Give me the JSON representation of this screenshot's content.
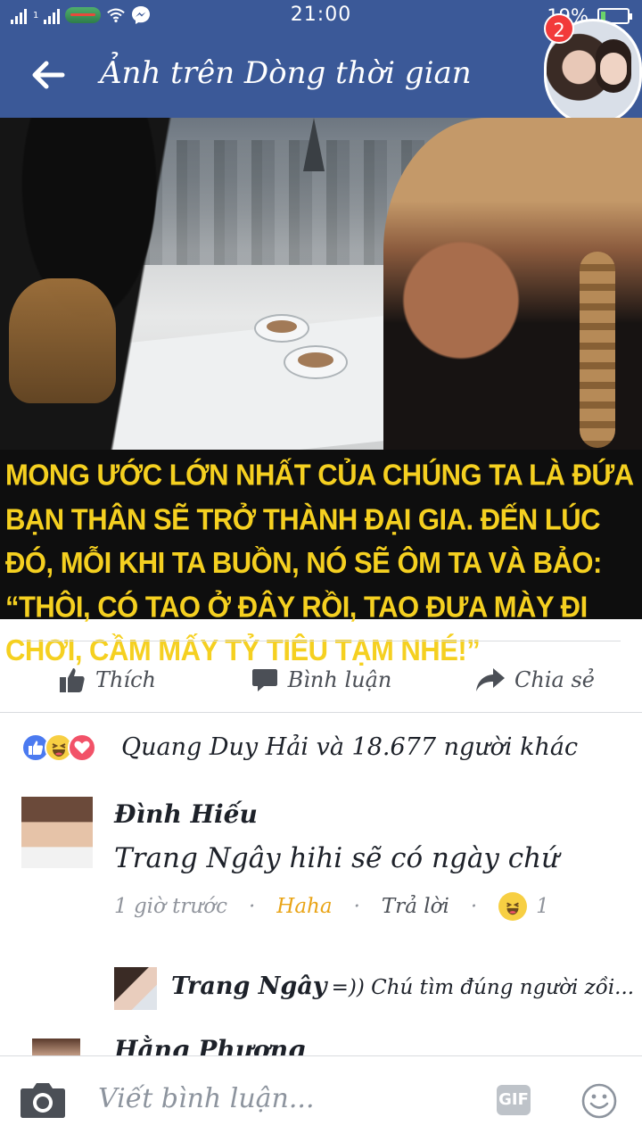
{
  "status_bar": {
    "time": "21:00",
    "battery_percent": "19%",
    "battery_level": 0.19,
    "carrier_icon": "carrier-logo-icon",
    "signal_label": "1"
  },
  "header": {
    "title": "Ảnh trên Dòng thời gian",
    "back_icon": "back-arrow-icon",
    "chat_badge": "2"
  },
  "post": {
    "caption": "Mong ước lớn nhất của chúng ta là đứa bạn thân sẽ trở thành đại gia. Đến lúc đó, mỗi khi ta buồn, nó sẽ ôm ta và bảo: “Thôi, có tao ở đây rồi, tao đưa mày đi chơi, cầm mấy tỷ tiêu tạm nhé!”"
  },
  "actions": {
    "like": "Thích",
    "comment": "Bình luận",
    "share": "Chia sẻ"
  },
  "reactions": {
    "summary": "Quang Duy Hải và 18.677 người khác"
  },
  "comments": [
    {
      "name": "Đình Hiếu",
      "text": "Trang Ngây hihi sẽ có ngày chứ",
      "time": "1 giờ trước",
      "reaction_label": "Haha",
      "reply_label": "Trả lời",
      "reaction_count": "1",
      "reply": {
        "name": "Trang Ngây",
        "text": "=)) Chú tìm đúng người zồi..."
      }
    },
    {
      "name": "Hằng Phương"
    }
  ],
  "composer": {
    "placeholder": "Viết bình luận...",
    "gif_label": "GIF"
  },
  "colors": {
    "facebook_blue": "#3b5998",
    "caption_yellow": "#f5d020",
    "haha_orange": "#e9a416"
  }
}
